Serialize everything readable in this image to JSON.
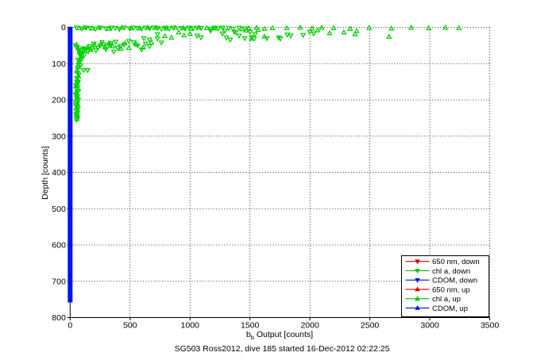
{
  "figure": {
    "background": "#ffffff",
    "caption": "SG503 Ross2012, dive 185 started 16-Dec-2012 02:22:25"
  },
  "x_axis": {
    "label_base": "b",
    "label_sub": "b",
    "label_rest": " Output [counts]",
    "ticks": [
      0,
      500,
      1000,
      1500,
      2000,
      2500,
      3000,
      3500
    ]
  },
  "y_axis": {
    "label": "Depth [counts]",
    "ticks": [
      0,
      100,
      200,
      300,
      400,
      500,
      600,
      700,
      800
    ]
  },
  "legend": {
    "entries": [
      {
        "label": "650 nm, down",
        "color": "#cc0000",
        "marker": "down"
      },
      {
        "label": "chl a, down",
        "color": "#00c400",
        "marker": "down"
      },
      {
        "label": "CDOM, down",
        "color": "#0010e8",
        "marker": "down"
      },
      {
        "label": "650 nm, up",
        "color": "#cc0000",
        "marker": "up"
      },
      {
        "label": "chl a, up",
        "color": "#00c400",
        "marker": "up"
      },
      {
        "label": "CDOM, up",
        "color": "#0010e8",
        "marker": "up"
      }
    ]
  },
  "chart_data": {
    "type": "scatter",
    "title": "SG503 Ross2012, dive 185 started 16-Dec-2012 02:22:25",
    "xlabel": "b_b Output [counts]",
    "ylabel": "Depth [counts]",
    "xlim": [
      0,
      3500
    ],
    "ylim": [
      0,
      800
    ],
    "y_direction": "reversed",
    "grid": true,
    "legend_position": "lower right",
    "series": [
      {
        "name": "chl a, down",
        "color": "#00d000",
        "marker": "down",
        "points": [
          [
            53,
            1
          ],
          [
            99,
            3
          ],
          [
            132,
            1
          ],
          [
            165,
            2
          ],
          [
            212,
            4
          ],
          [
            251,
            1
          ],
          [
            298,
            3
          ],
          [
            344,
            1
          ],
          [
            377,
            2
          ],
          [
            410,
            5
          ],
          [
            450,
            1
          ],
          [
            496,
            3
          ],
          [
            529,
            1
          ],
          [
            562,
            2
          ],
          [
            595,
            4
          ],
          [
            629,
            1
          ],
          [
            662,
            3
          ],
          [
            695,
            1
          ],
          [
            728,
            2
          ],
          [
            761,
            4
          ],
          [
            794,
            1
          ],
          [
            827,
            3
          ],
          [
            860,
            1
          ],
          [
            926,
            2
          ],
          [
            959,
            4
          ],
          [
            992,
            1
          ],
          [
            1025,
            3
          ],
          [
            1059,
            1
          ],
          [
            1092,
            2
          ],
          [
            1171,
            4
          ],
          [
            1204,
            1
          ],
          [
            1237,
            3
          ],
          [
            1270,
            1
          ],
          [
            1323,
            2
          ],
          [
            1356,
            4
          ],
          [
            1409,
            1
          ],
          [
            1456,
            3
          ],
          [
            615,
            30
          ],
          [
            662,
            34
          ],
          [
            728,
            19
          ],
          [
            1270,
            17
          ],
          [
            1303,
            28
          ],
          [
            1336,
            34
          ],
          [
            1369,
            12
          ],
          [
            1409,
            23
          ],
          [
            1456,
            30
          ],
          [
            1502,
            12
          ],
          [
            1542,
            19
          ],
          [
            1641,
            30
          ],
          [
            1740,
            28
          ],
          [
            1840,
            23
          ],
          [
            1998,
            12
          ],
          [
            2031,
            17
          ],
          [
            1943,
            21
          ],
          [
            1811,
            20
          ],
          [
            1753,
            31
          ],
          [
            1535,
            31
          ],
          [
            1513,
            27
          ],
          [
            1381,
            13
          ],
          [
            1292,
            9
          ],
          [
            1059,
            23
          ],
          [
            1092,
            28
          ],
          [
            1171,
            9
          ],
          [
            132,
            60
          ],
          [
            165,
            52
          ],
          [
            198,
            45
          ],
          [
            232,
            56
          ],
          [
            265,
            41
          ],
          [
            298,
            60
          ],
          [
            331,
            49
          ],
          [
            364,
            67
          ],
          [
            397,
            56
          ],
          [
            530,
            41
          ],
          [
            562,
            50
          ],
          [
            595,
            61
          ],
          [
            629,
            45
          ],
          [
            662,
            52
          ],
          [
            728,
            31
          ],
          [
            761,
            42
          ],
          [
            450,
            47
          ],
          [
            490,
            38
          ],
          [
            215,
            63
          ],
          [
            180,
            58
          ],
          [
            150,
            66
          ],
          [
            250,
            50
          ],
          [
            280,
            47
          ],
          [
            310,
            53
          ],
          [
            340,
            44
          ],
          [
            380,
            40
          ],
          [
            420,
            52
          ],
          [
            46,
            50
          ],
          [
            79,
            72
          ],
          [
            112,
            118
          ],
          [
            146,
            118
          ],
          [
            60,
            55
          ],
          [
            73,
            64
          ],
          [
            86,
            78
          ],
          [
            66,
            90
          ],
          [
            93,
            62
          ],
          [
            106,
            58
          ],
          [
            126,
            60
          ],
          [
            99,
            86
          ],
          [
            86,
            105
          ],
          [
            73,
            130
          ],
          [
            66,
            150
          ],
          [
            93,
            72
          ],
          [
            106,
            70
          ],
          [
            119,
            75
          ],
          [
            80,
            95
          ],
          [
            70,
            110
          ],
          [
            60,
            125
          ],
          [
            55,
            140
          ],
          [
            55,
            150
          ],
          [
            62,
            155
          ],
          [
            48,
            160
          ],
          [
            65,
            165
          ],
          [
            52,
            170
          ],
          [
            68,
            175
          ],
          [
            58,
            180
          ],
          [
            45,
            185
          ],
          [
            62,
            190
          ],
          [
            55,
            195
          ],
          [
            68,
            200
          ],
          [
            50,
            205
          ],
          [
            60,
            210
          ],
          [
            47,
            215
          ],
          [
            57,
            220
          ],
          [
            66,
            225
          ],
          [
            52,
            230
          ],
          [
            61,
            235
          ],
          [
            48,
            240
          ],
          [
            58,
            245
          ],
          [
            64,
            250
          ],
          [
            54,
            255
          ]
        ]
      },
      {
        "name": "chl a, up",
        "color": "#00d000",
        "marker": "up",
        "points": [
          [
            1807,
            2
          ],
          [
            1919,
            1
          ],
          [
            2018,
            3
          ],
          [
            2098,
            1
          ],
          [
            2197,
            2
          ],
          [
            2336,
            4
          ],
          [
            2495,
            1
          ],
          [
            2680,
            3
          ],
          [
            2845,
            1
          ],
          [
            2991,
            2
          ],
          [
            3130,
            1
          ],
          [
            3243,
            2
          ],
          [
            73,
            2
          ],
          [
            119,
            1
          ],
          [
            185,
            3
          ],
          [
            240,
            1
          ],
          [
            320,
            4
          ],
          [
            430,
            1
          ],
          [
            510,
            2
          ],
          [
            580,
            3
          ],
          [
            650,
            1
          ],
          [
            720,
            1
          ],
          [
            800,
            3
          ],
          [
            880,
            1
          ],
          [
            945,
            2
          ],
          [
            1010,
            4
          ],
          [
            1075,
            1
          ],
          [
            1140,
            2
          ],
          [
            1205,
            3
          ],
          [
            1489,
            2
          ],
          [
            1555,
            1
          ],
          [
            1621,
            4
          ],
          [
            1688,
            2
          ],
          [
            1436,
            5
          ],
          [
            1469,
            9
          ],
          [
            1568,
            7
          ],
          [
            2064,
            8
          ],
          [
            2164,
            16
          ],
          [
            2283,
            14
          ],
          [
            2376,
            19
          ],
          [
            2389,
            10
          ],
          [
            2660,
            26
          ],
          [
            905,
            14
          ],
          [
            950,
            22
          ],
          [
            845,
            28
          ],
          [
            790,
            24
          ],
          [
            1000,
            18
          ],
          [
            1513,
            31
          ],
          [
            1620,
            25
          ],
          [
            258,
            46
          ],
          [
            291,
            55
          ],
          [
            324,
            43
          ],
          [
            357,
            52
          ],
          [
            424,
            59
          ],
          [
            457,
            44
          ],
          [
            490,
            57
          ],
          [
            550,
            47
          ],
          [
            610,
            55
          ],
          [
            680,
            42
          ],
          [
            145,
            55
          ],
          [
            172,
            62
          ],
          [
            205,
            49
          ],
          [
            52,
            48
          ],
          [
            66,
            58
          ],
          [
            79,
            68
          ],
          [
            92,
            80
          ],
          [
            72,
            95
          ],
          [
            62,
            108
          ],
          [
            82,
            88
          ],
          [
            56,
            120
          ],
          [
            70,
            135
          ],
          [
            64,
            145
          ],
          [
            58,
            152
          ],
          [
            50,
            162
          ],
          [
            66,
            172
          ],
          [
            54,
            182
          ],
          [
            60,
            192
          ],
          [
            48,
            202
          ],
          [
            63,
            212
          ],
          [
            53,
            222
          ],
          [
            59,
            232
          ],
          [
            51,
            242
          ],
          [
            57,
            252
          ]
        ]
      },
      {
        "name": "CDOM, down + CDOM, up",
        "color": "#0013ef",
        "marker": "bar",
        "bar": {
          "x_range": [
            0,
            40
          ],
          "depth_range": [
            0,
            760
          ]
        }
      }
    ]
  }
}
